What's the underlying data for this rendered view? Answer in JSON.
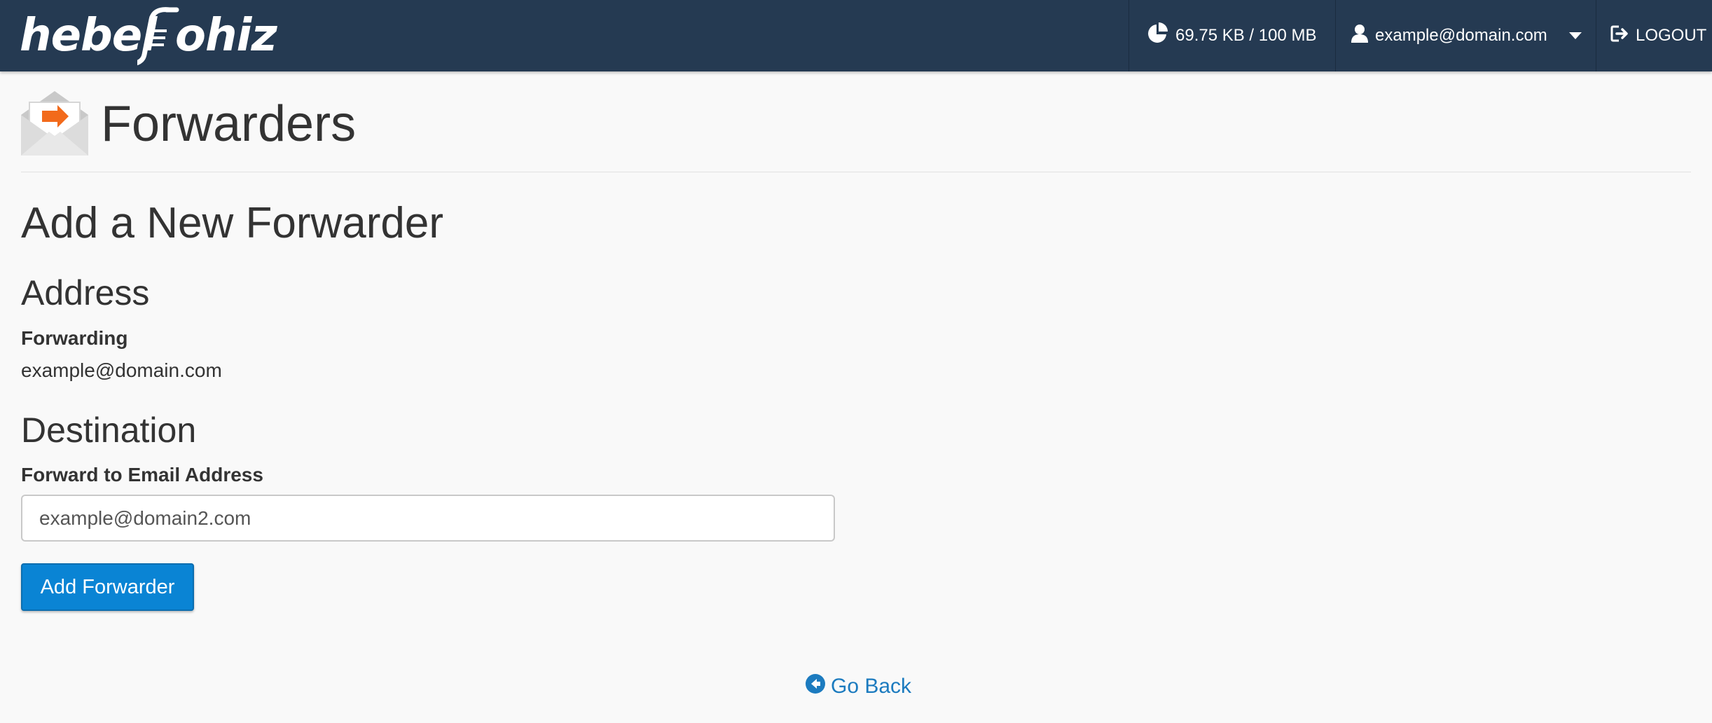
{
  "topbar": {
    "logo_left": "hebel",
    "logo_right": "ohiz",
    "disk_usage": "69.75 KB / 100 MB",
    "disk_icon": "pie-chart-icon",
    "user_email": "example@domain.com",
    "user_icon": "user-icon",
    "logout_label": "LOGOUT",
    "logout_icon": "sign-out-icon"
  },
  "page": {
    "title": "Forwarders",
    "icon": "email-forward-icon"
  },
  "form": {
    "heading": "Add a New Forwarder",
    "address_heading": "Address",
    "forwarding_label": "Forwarding",
    "forwarding_value": "example@domain.com",
    "destination_heading": "Destination",
    "forward_to_label": "Forward to Email Address",
    "forward_to_value": "example@domain2.com",
    "submit_label": "Add Forwarder"
  },
  "footer": {
    "go_back_label": "Go Back",
    "go_back_icon": "arrow-circle-left-icon"
  },
  "colors": {
    "topbar_bg": "#253a52",
    "primary_button": "#0a84d4",
    "link": "#1c7bbf",
    "accent_orange": "#f26a1b"
  }
}
